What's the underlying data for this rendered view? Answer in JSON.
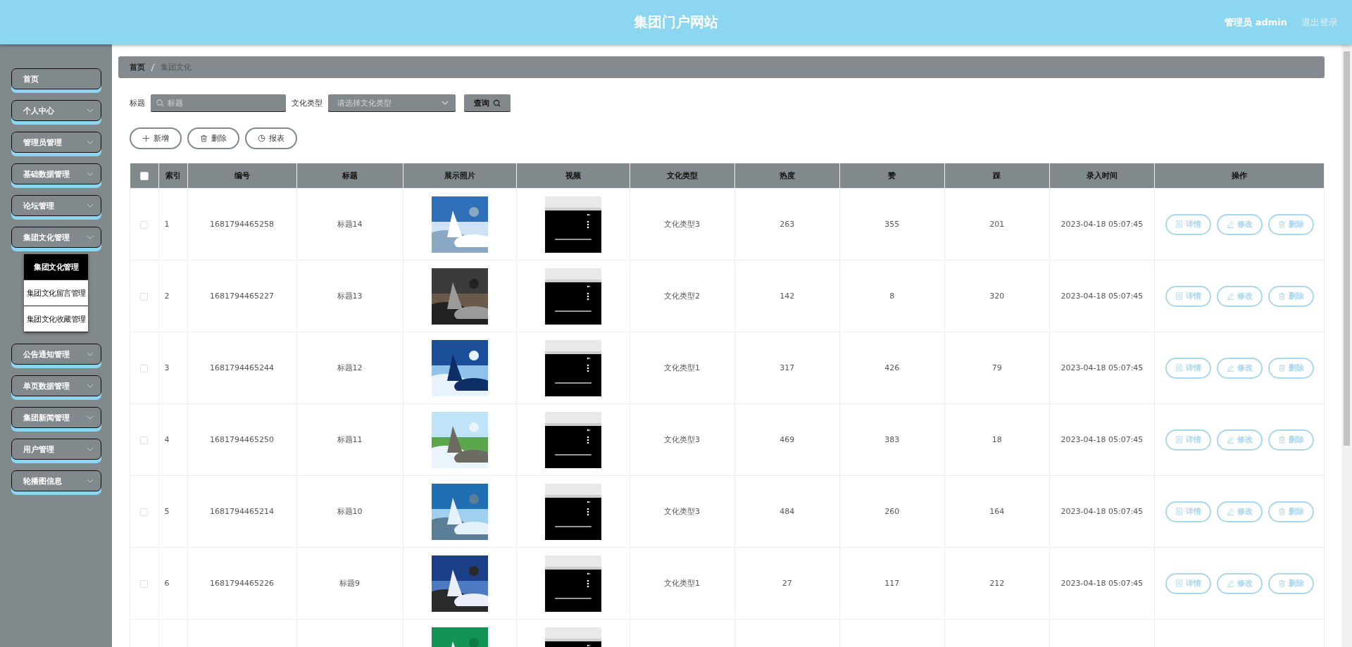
{
  "header": {
    "title": "集团门户网站",
    "user": "管理员 admin",
    "logout": "退出登录"
  },
  "sidebar": {
    "items": [
      {
        "label": "首页",
        "kind": "link"
      },
      {
        "label": "个人中心",
        "kind": "menu"
      },
      {
        "label": "管理员管理",
        "kind": "menu"
      },
      {
        "label": "基础数据管理",
        "kind": "menu"
      },
      {
        "label": "论坛管理",
        "kind": "menu"
      },
      {
        "label": "集团文化管理",
        "kind": "menu",
        "children": [
          {
            "label": "集团文化管理",
            "selected": true
          },
          {
            "label": "集团文化留言管理",
            "selected": false
          },
          {
            "label": "集团文化收藏管理",
            "selected": false
          }
        ]
      },
      {
        "label": "公告通知管理",
        "kind": "menu"
      },
      {
        "label": "单页数据管理",
        "kind": "menu"
      },
      {
        "label": "集团新闻管理",
        "kind": "menu"
      },
      {
        "label": "用户管理",
        "kind": "menu"
      },
      {
        "label": "轮播图信息",
        "kind": "menu"
      }
    ]
  },
  "breadcrumb": [
    "首页",
    "集团文化"
  ],
  "search": {
    "title_label": "标题",
    "title_placeholder": "标题",
    "type_label": "文化类型",
    "type_placeholder": "请选择文化类型",
    "button": "查询"
  },
  "actions": [
    {
      "label": "新增",
      "kind": "add"
    },
    {
      "label": "删除",
      "kind": "delete"
    },
    {
      "label": "报表",
      "kind": "chart"
    }
  ],
  "table": {
    "columns": [
      "索引",
      "编号",
      "标题",
      "展示照片",
      "视频",
      "文化类型",
      "热度",
      "赞",
      "踩",
      "录入时间",
      "操作"
    ],
    "all_selected": false,
    "rows": [
      {
        "selected": false,
        "index": "1",
        "code": "1681794465258",
        "title": "标题14",
        "video": {
          "kind": "player"
        },
        "type": "文化类型3",
        "heat": "263",
        "likes": "355",
        "dislikes": "201",
        "time": "2023-04-18 05:07:45",
        "buttons": [
          "详情",
          "修改",
          "删除"
        ]
      },
      {
        "selected": false,
        "index": "2",
        "code": "1681794465227",
        "title": "标题13",
        "video": {
          "kind": "player"
        },
        "type": "文化类型2",
        "heat": "142",
        "likes": "8",
        "dislikes": "320",
        "time": "2023-04-18 05:07:45",
        "buttons": [
          "详情",
          "修改",
          "删除"
        ]
      },
      {
        "selected": false,
        "index": "3",
        "code": "1681794465244",
        "title": "标题12",
        "video": {
          "kind": "player"
        },
        "type": "文化类型1",
        "heat": "317",
        "likes": "426",
        "dislikes": "79",
        "time": "2023-04-18 05:07:45",
        "buttons": [
          "详情",
          "修改",
          "删除"
        ]
      },
      {
        "selected": false,
        "index": "4",
        "code": "1681794465250",
        "title": "标题11",
        "video": {
          "kind": "player"
        },
        "type": "文化类型3",
        "heat": "469",
        "likes": "383",
        "dislikes": "18",
        "time": "2023-04-18 05:07:45",
        "buttons": [
          "详情",
          "修改",
          "删除"
        ]
      },
      {
        "selected": false,
        "index": "5",
        "code": "1681794465214",
        "title": "标题10",
        "video": {
          "kind": "player"
        },
        "type": "文化类型3",
        "heat": "484",
        "likes": "260",
        "dislikes": "164",
        "time": "2023-04-18 05:07:45",
        "buttons": [
          "详情",
          "修改",
          "删除"
        ]
      },
      {
        "selected": false,
        "index": "6",
        "code": "1681794465226",
        "title": "标题9",
        "video": {
          "kind": "player"
        },
        "type": "文化类型1",
        "heat": "27",
        "likes": "117",
        "dislikes": "212",
        "time": "2023-04-18 05:07:45",
        "buttons": [
          "详情",
          "修改",
          "删除"
        ]
      },
      {
        "video": {
          "kind": "player"
        }
      }
    ]
  }
}
